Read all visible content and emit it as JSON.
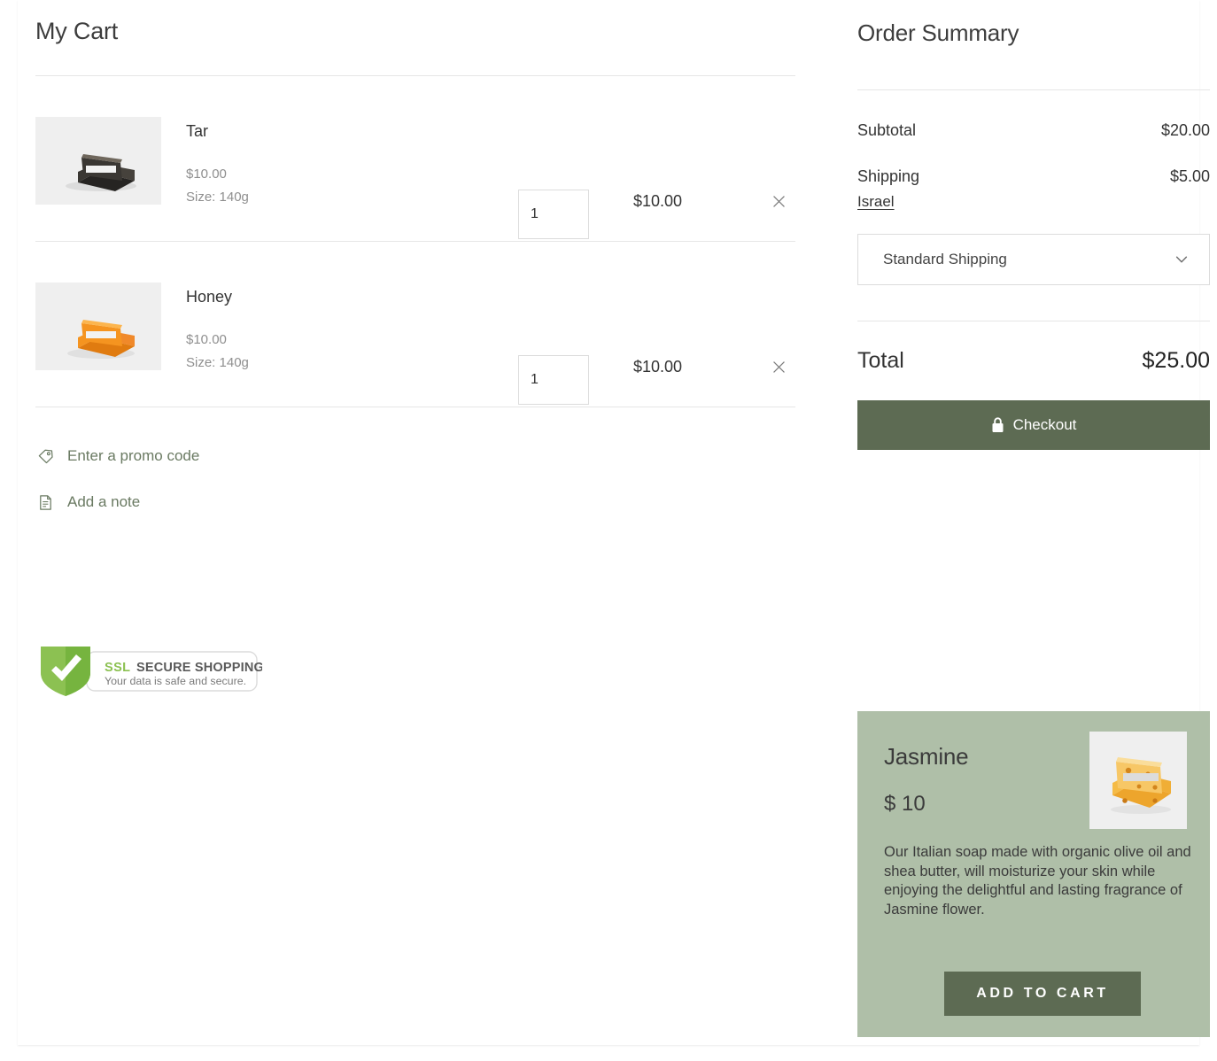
{
  "cart": {
    "title": "My Cart",
    "items": [
      {
        "name": "Tar",
        "unit_price": "$10.00",
        "size": "Size: 140g",
        "quantity": "1",
        "line_total": "$10.00",
        "image_alt": "tar-soap",
        "soap_color": "#3a3733",
        "soap_color_dark": "#262422",
        "soap_color_light": "#5b564f"
      },
      {
        "name": "Honey",
        "unit_price": "$10.00",
        "size": "Size: 140g",
        "quantity": "1",
        "line_total": "$10.00",
        "image_alt": "honey-soap",
        "soap_color": "#f59420",
        "soap_color_dark": "#e07b10",
        "soap_color_light": "#fcb54e"
      }
    ],
    "promo_code_label": "Enter a promo code",
    "add_note_label": "Add a note",
    "ssl_badge": {
      "brand": "SSL",
      "headline": "SECURE SHOPPING",
      "subline": "Your data is safe and secure."
    }
  },
  "summary": {
    "title": "Order Summary",
    "subtotal_label": "Subtotal",
    "subtotal_value": "$20.00",
    "shipping_label": "Shipping",
    "shipping_value": "$5.00",
    "country": "Israel",
    "shipping_method": "Standard Shipping",
    "total_label": "Total",
    "total_value": "$25.00",
    "checkout_label": "Checkout"
  },
  "promo_card": {
    "name": "Jasmine",
    "price": "$ 10",
    "description": "Our Italian soap made with organic olive oil and shea butter, will moisturize your skin while enjoying the delightful and lasting fragrance of Jasmine flower.",
    "add_to_cart_label": "ADD TO CART",
    "image_alt": "jasmine-soap"
  },
  "colors": {
    "accent_green": "#5d6b53",
    "card_green": "#afbfa8",
    "link_green": "#6a7a62",
    "muted_text": "#8f8f8f",
    "rule": "#e6e6e6"
  }
}
